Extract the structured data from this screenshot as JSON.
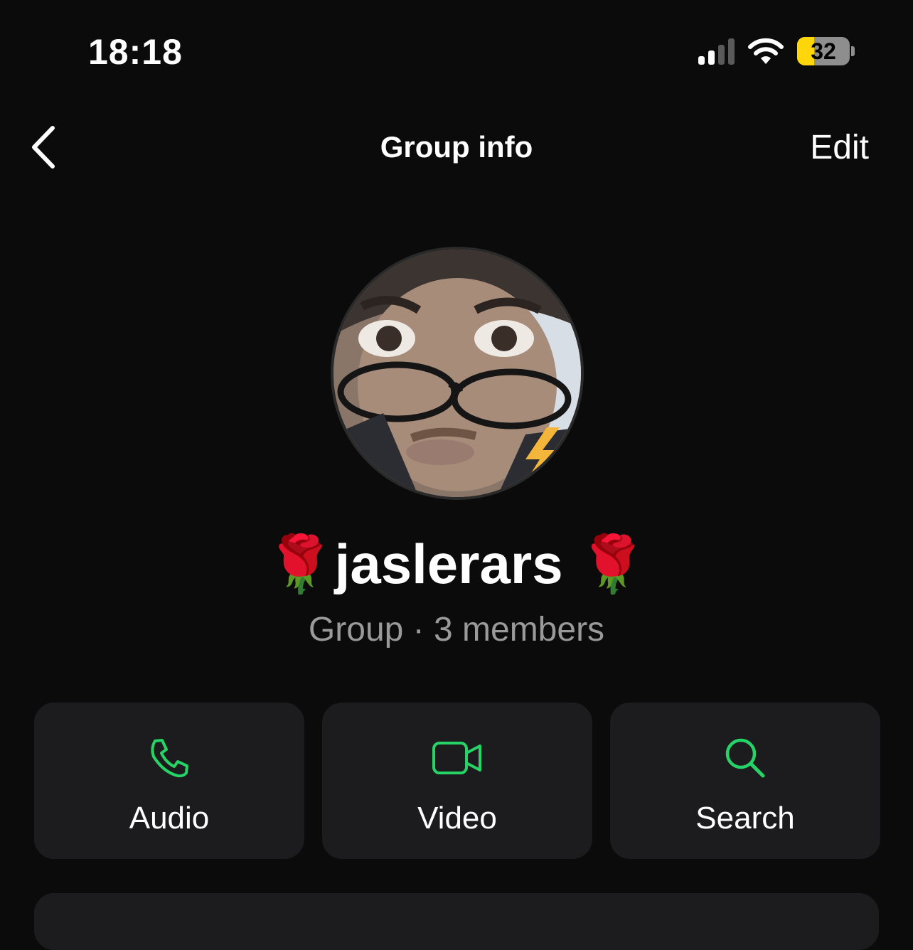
{
  "status_bar": {
    "time": "18:18",
    "battery_level": "32",
    "battery_fraction": 0.32,
    "signal_bars_active": 2,
    "signal_bars_total": 4
  },
  "nav": {
    "back_icon": "chevron-left-icon",
    "title": "Group info",
    "edit_label": "Edit"
  },
  "group": {
    "name": "🌹jaslerars 🌹",
    "subtitle": "Group · 3 members"
  },
  "actions": [
    {
      "label": "Audio",
      "icon": "phone-icon"
    },
    {
      "label": "Video",
      "icon": "video-camera-icon"
    },
    {
      "label": "Search",
      "icon": "search-icon"
    }
  ],
  "colors": {
    "background": "#0b0b0b",
    "card": "#1c1c1e",
    "accent_green": "#25d366",
    "battery_yellow": "#ffd60a",
    "secondary_text": "#9a9a9a"
  }
}
